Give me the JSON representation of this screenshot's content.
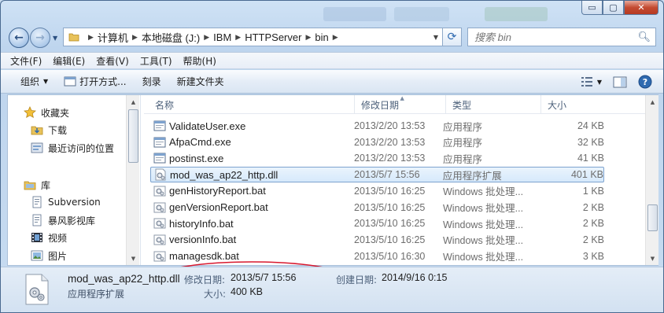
{
  "window": {
    "minimize_glyph": "▭",
    "maximize_glyph": "▢",
    "close_glyph": "✕"
  },
  "address": {
    "crumbs": [
      "计算机",
      "本地磁盘 (J:)",
      "IBM",
      "HTTPServer",
      "bin"
    ]
  },
  "search": {
    "placeholder": "搜索 bin"
  },
  "menu": [
    "文件(F)",
    "编辑(E)",
    "查看(V)",
    "工具(T)",
    "帮助(H)"
  ],
  "commands": {
    "organize": "组织",
    "open_with": "打开方式...",
    "burn": "刻录",
    "new_folder": "新建文件夹"
  },
  "nav": {
    "favorites": "收藏夹",
    "downloads": "下载",
    "recent": "最近访问的位置",
    "libraries": "库",
    "subversion": "Subversion",
    "baofeng": "暴风影视库",
    "videos": "视频",
    "pictures": "图片"
  },
  "columns": {
    "name": "名称",
    "date": "修改日期",
    "type": "类型",
    "size": "大小"
  },
  "files": [
    {
      "name": "ValidateUser.exe",
      "date": "2013/2/20 13:53",
      "type": "应用程序",
      "size": "24 KB",
      "icon": "exe-icon"
    },
    {
      "name": "AfpaCmd.exe",
      "date": "2013/2/20 13:53",
      "type": "应用程序",
      "size": "32 KB",
      "icon": "exe-icon"
    },
    {
      "name": "postinst.exe",
      "date": "2013/2/20 13:53",
      "type": "应用程序",
      "size": "41 KB",
      "icon": "exe-icon"
    },
    {
      "name": "mod_was_ap22_http.dll",
      "date": "2013/5/7 15:56",
      "type": "应用程序扩展",
      "size": "401 KB",
      "icon": "dll-icon",
      "selected": true
    },
    {
      "name": "genHistoryReport.bat",
      "date": "2013/5/10 16:25",
      "type": "Windows 批处理...",
      "size": "1 KB",
      "icon": "bat-icon"
    },
    {
      "name": "genVersionReport.bat",
      "date": "2013/5/10 16:25",
      "type": "Windows 批处理...",
      "size": "2 KB",
      "icon": "bat-icon"
    },
    {
      "name": "historyInfo.bat",
      "date": "2013/5/10 16:25",
      "type": "Windows 批处理...",
      "size": "2 KB",
      "icon": "bat-icon"
    },
    {
      "name": "versionInfo.bat",
      "date": "2013/5/10 16:25",
      "type": "Windows 批处理...",
      "size": "2 KB",
      "icon": "bat-icon"
    },
    {
      "name": "managesdk.bat",
      "date": "2013/5/10 16:30",
      "type": "Windows 批处理...",
      "size": "3 KB",
      "icon": "bat-icon"
    }
  ],
  "details": {
    "name": "mod_was_ap22_http.dll",
    "type": "应用程序扩展",
    "modified_label": "修改日期:",
    "modified_value": "2013/5/7 15:56",
    "created_label": "创建日期:",
    "created_value": "2014/9/16 0:15",
    "size_label": "大小:",
    "size_value": "400 KB"
  },
  "colors": {
    "selection_border": "#7da2ce",
    "annotation": "#d8182e",
    "title_bg": "#c9dcf0"
  }
}
